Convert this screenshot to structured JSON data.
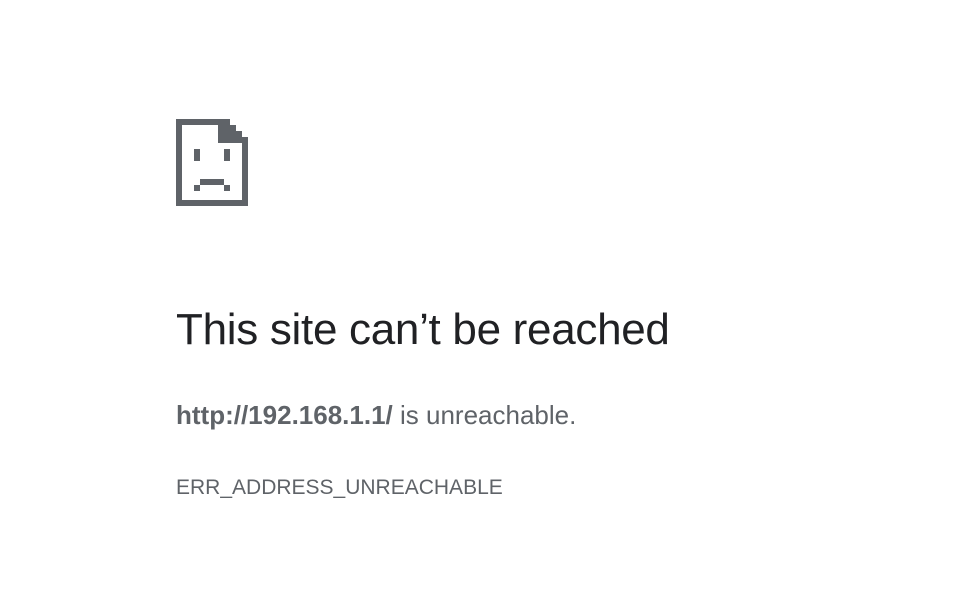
{
  "error_page": {
    "icon": "sad-document-icon",
    "title": "This site can’t be reached",
    "url": "http://192.168.1.1/",
    "summary_suffix": " is unreachable.",
    "error_code": "ERR_ADDRESS_UNREACHABLE"
  },
  "colors": {
    "background": "#ffffff",
    "title": "#202124",
    "body_text": "#5f6368",
    "icon": "#5f6368"
  }
}
